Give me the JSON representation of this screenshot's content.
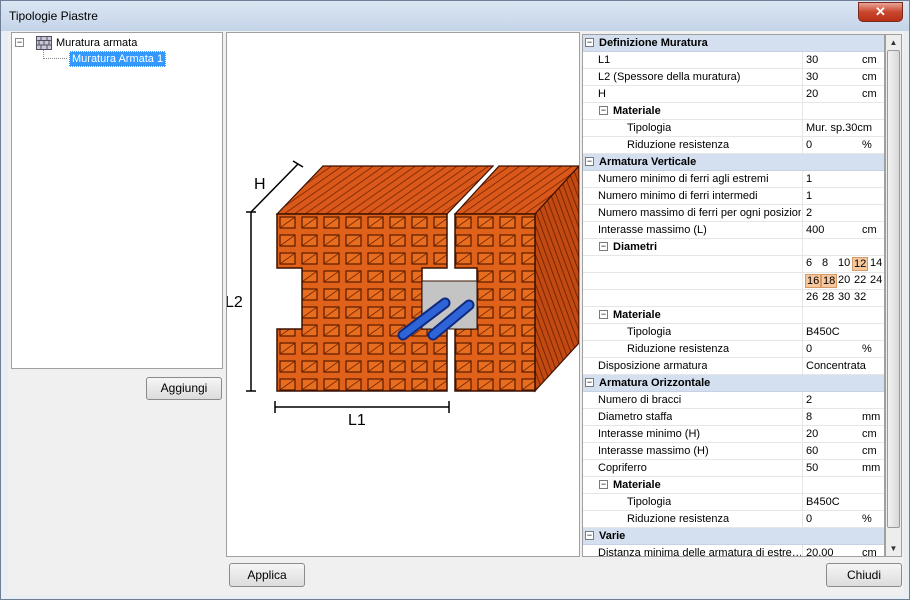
{
  "window": {
    "title": "Tipologie Piastre",
    "close_glyph": "✕"
  },
  "tree": {
    "root": {
      "label": "Muratura armata",
      "expander": "−",
      "icon": "wall-icon"
    },
    "child": {
      "label": "Muratura Armata 1"
    }
  },
  "buttons": {
    "add": "Aggiungi",
    "apply": "Applica",
    "close": "Chiudi"
  },
  "diagram": {
    "label_h": "H",
    "label_l1": "L1",
    "label_l2": "L2"
  },
  "grid": {
    "toggle": "−",
    "definizione": {
      "title": "Definizione Muratura",
      "l1": {
        "name": "L1",
        "value": "30",
        "unit": "cm"
      },
      "l2": {
        "name": "L2 (Spessore della muratura)",
        "value": "30",
        "unit": "cm"
      },
      "h": {
        "name": "H",
        "value": "20",
        "unit": "cm"
      },
      "materiale": "Materiale",
      "tipologia": {
        "name": "Tipologia",
        "value": "Mur. sp.30cm"
      },
      "riduzione": {
        "name": "Riduzione resistenza",
        "value": "0",
        "unit": "%"
      }
    },
    "verticale": {
      "title": "Armatura Verticale",
      "min_estremi": {
        "name": "Numero minimo di ferri agli estremi",
        "value": "1"
      },
      "min_intermedi": {
        "name": "Numero minimo di ferri intermedi",
        "value": "1"
      },
      "max_posizione": {
        "name": "Numero massimo di ferri per ogni posizione",
        "value": "2"
      },
      "interasse": {
        "name": "Interasse massimo (L)",
        "value": "400",
        "unit": "cm"
      },
      "diametri": "Diametri",
      "diam_row1": [
        "6",
        "8",
        "10",
        "12",
        "14"
      ],
      "diam_row2": [
        "16",
        "18",
        "20",
        "22",
        "24"
      ],
      "diam_row3": [
        "26",
        "28",
        "30",
        "32"
      ],
      "materiale": "Materiale",
      "tipologia": {
        "name": "Tipologia",
        "value": "B450C"
      },
      "riduzione": {
        "name": "Riduzione resistenza",
        "value": "0",
        "unit": "%"
      },
      "disposizione": {
        "name": "Disposizione armatura",
        "value": "Concentrata"
      }
    },
    "orizzontale": {
      "title": "Armatura Orizzontale",
      "bracci": {
        "name": "Numero di bracci",
        "value": "2"
      },
      "diametro": {
        "name": "Diametro staffa",
        "value": "8",
        "unit": "mm"
      },
      "int_min": {
        "name": "Interasse minimo (H)",
        "value": "20",
        "unit": "cm"
      },
      "int_max": {
        "name": "Interasse massimo (H)",
        "value": "60",
        "unit": "cm"
      },
      "copriferro": {
        "name": "Copriferro",
        "value": "50",
        "unit": "mm"
      },
      "materiale": "Materiale",
      "tipologia": {
        "name": "Tipologia",
        "value": "B450C"
      },
      "riduzione": {
        "name": "Riduzione resistenza",
        "value": "0",
        "unit": "%"
      }
    },
    "varie": {
      "title": "Varie",
      "distanza": {
        "name": "Distanza minima delle armatura di estre…",
        "value": "20,00",
        "unit": "cm"
      }
    }
  },
  "colors": {
    "brick": "#e0611a",
    "brick_dark": "#b9420e",
    "selection": "#3399ff",
    "category": "#d4dff0",
    "rebar": "#1f4fb8"
  }
}
